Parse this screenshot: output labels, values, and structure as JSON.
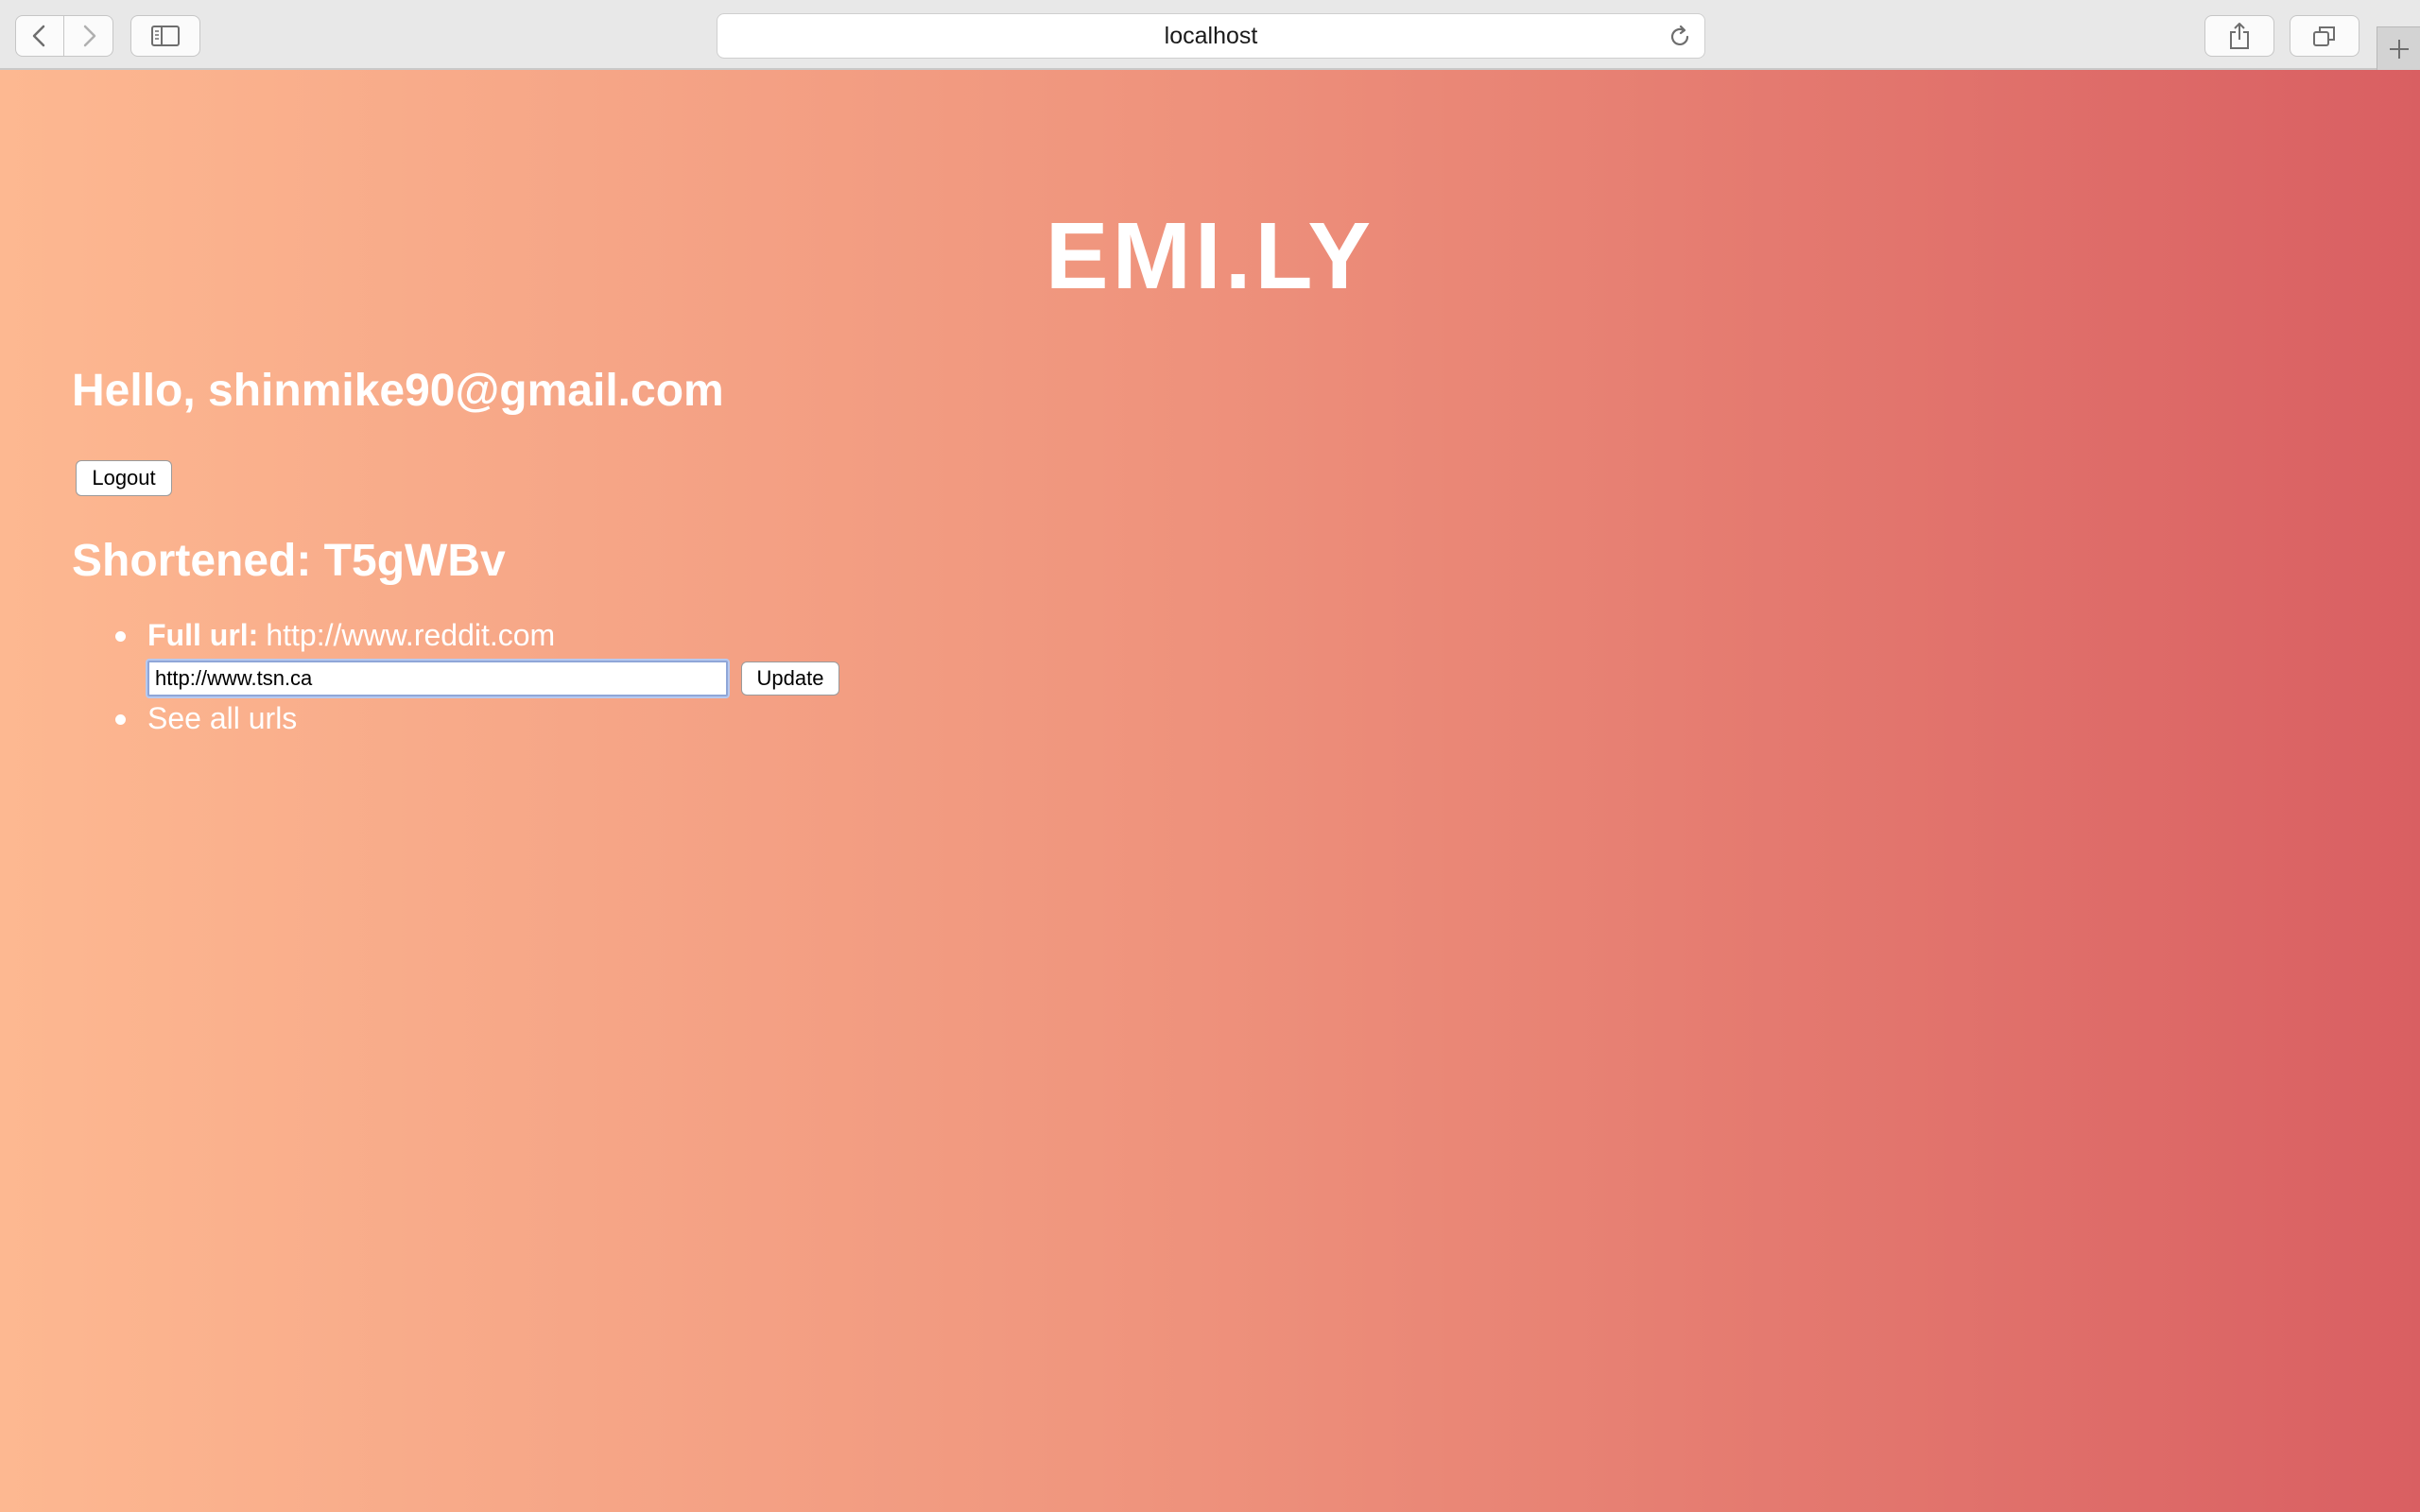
{
  "browser": {
    "address": "localhost",
    "icons": {
      "back": "chevron-left-icon",
      "forward": "chevron-right-icon",
      "sidebar": "sidebar-icon",
      "reload": "reload-icon",
      "share": "share-icon",
      "tabs": "tabs-icon",
      "new_tab": "plus-icon"
    }
  },
  "colors": {
    "gradient_start": "#fdb891",
    "gradient_mid": "#f0967e",
    "gradient_end": "#d95f62",
    "text": "#ffffff"
  },
  "app": {
    "brand": "EMI.LY",
    "greeting": "Hello, shinmike90@gmail.com",
    "logout_label": "Logout"
  },
  "url_detail": {
    "shortened_heading": "Shortened: T5gWBv",
    "full_url_label": "Full url:",
    "full_url_value": "http://www.reddit.com",
    "edit_value": "http://www.tsn.ca",
    "update_label": "Update",
    "see_all_label": "See all urls"
  }
}
